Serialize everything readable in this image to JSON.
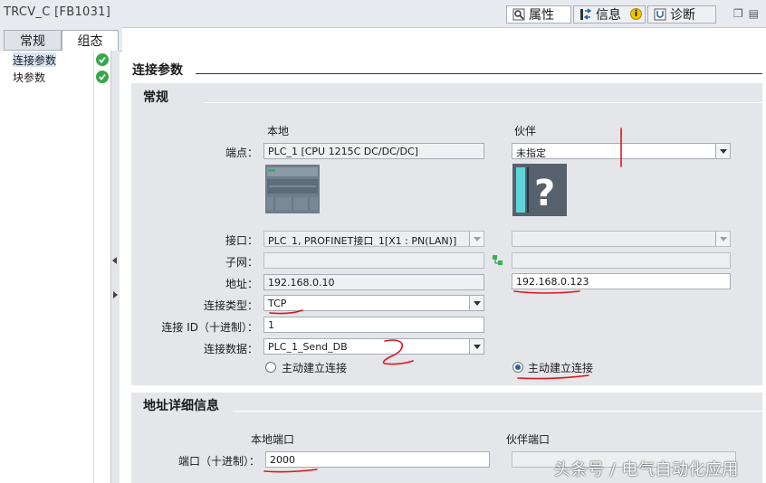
{
  "window": {
    "title": "TRCV_C [FB1031]"
  },
  "inspector_tabs": [
    {
      "label": "属性",
      "active": true
    },
    {
      "label": "信息",
      "active": false
    },
    {
      "label": "诊断",
      "active": false
    }
  ],
  "left_tabs": [
    {
      "label": "常规"
    },
    {
      "label": "组态"
    }
  ],
  "nav": [
    {
      "label": "连接参数",
      "status": "ok"
    },
    {
      "label": "块参数",
      "status": "ok"
    }
  ],
  "section": {
    "title": "连接参数"
  },
  "general": {
    "title": "常规",
    "local_header": "本地",
    "partner_header": "伙伴",
    "endpoint": {
      "label": "端点：",
      "local": "PLC_1 [CPU 1215C DC/DC/DC]",
      "partner": "未指定"
    },
    "interface": {
      "label": "接口：",
      "local": "PLC_1, PROFINET接口_1[X1 : PN(LAN)]",
      "partner": ""
    },
    "subnet": {
      "label": "子网：",
      "local": "",
      "partner": ""
    },
    "address": {
      "label": "地址：",
      "local": "192.168.0.10",
      "partner": "192.168.0.123"
    },
    "connection_type": {
      "label": "连接类型：",
      "value": "TCP"
    },
    "connection_id": {
      "label": "连接 ID（十进制）：",
      "value": "1"
    },
    "connection_data": {
      "label": "连接数据：",
      "value": "PLC_1_Send_DB"
    },
    "local_active": {
      "label": "主动建立连接",
      "checked": false
    },
    "partner_active": {
      "label": "主动建立连接",
      "checked": true
    }
  },
  "address_details": {
    "title": "地址详细信息",
    "local_port_header": "本地端口",
    "partner_port_header": "伙伴端口",
    "port": {
      "label": "端口（十进制）：",
      "local": "2000",
      "partner": ""
    }
  },
  "watermark": "头条号 / 电气自动化应用",
  "colors": {
    "accent": "#2c5ea8",
    "check": "#37a84a",
    "annotation": "#e0141e"
  }
}
